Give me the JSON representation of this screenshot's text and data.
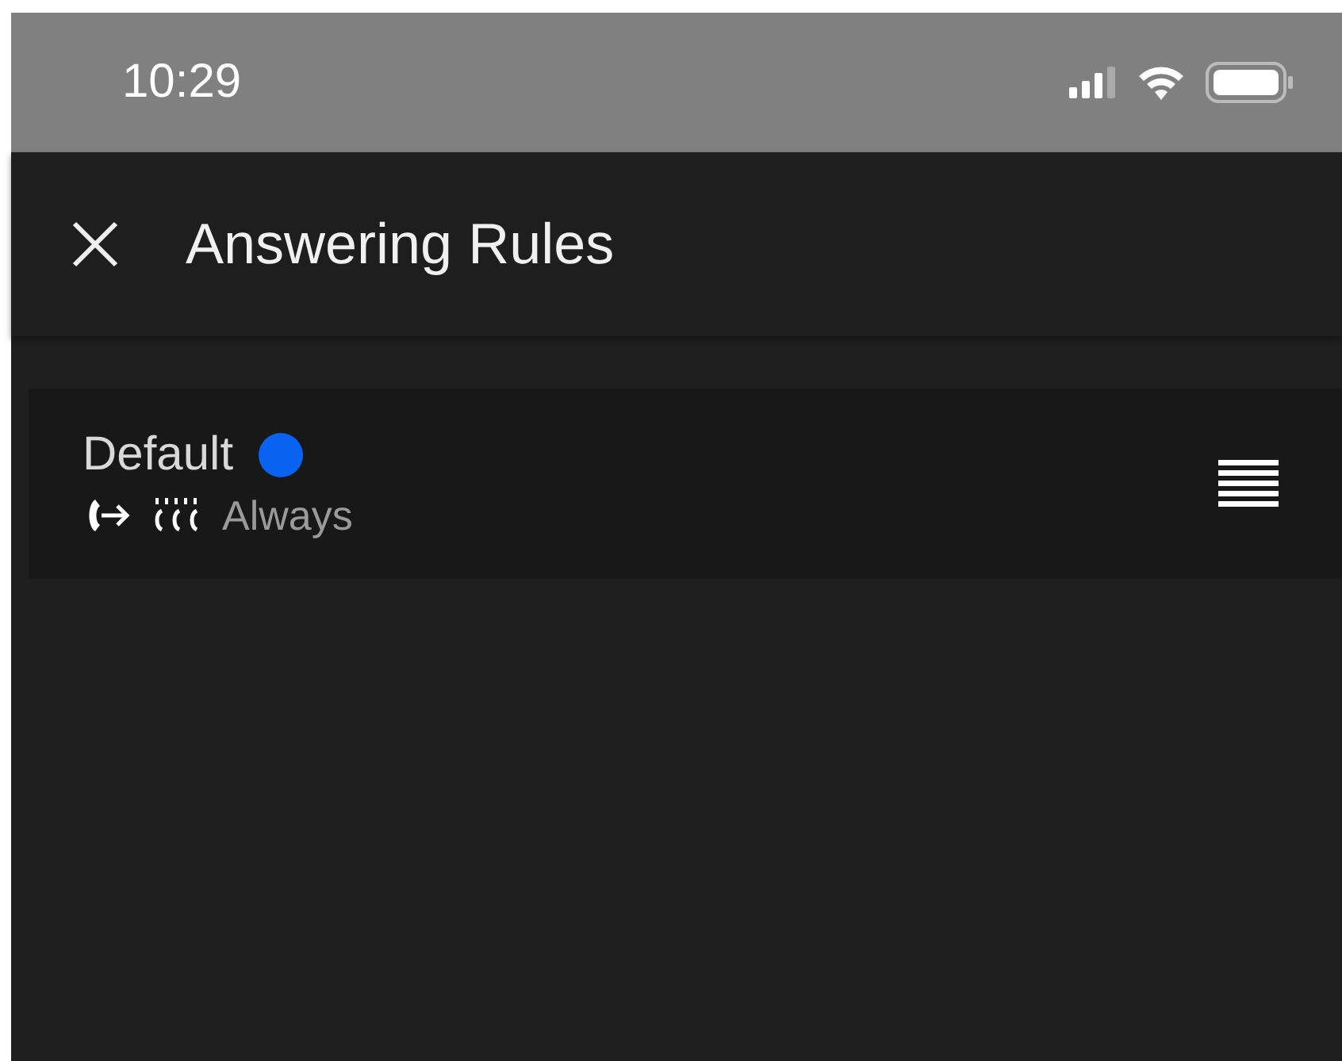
{
  "status_bar": {
    "time": "10:29"
  },
  "header": {
    "title": "Answering Rules"
  },
  "rules": [
    {
      "name": "Default",
      "active": true,
      "schedule": "Always"
    }
  ]
}
